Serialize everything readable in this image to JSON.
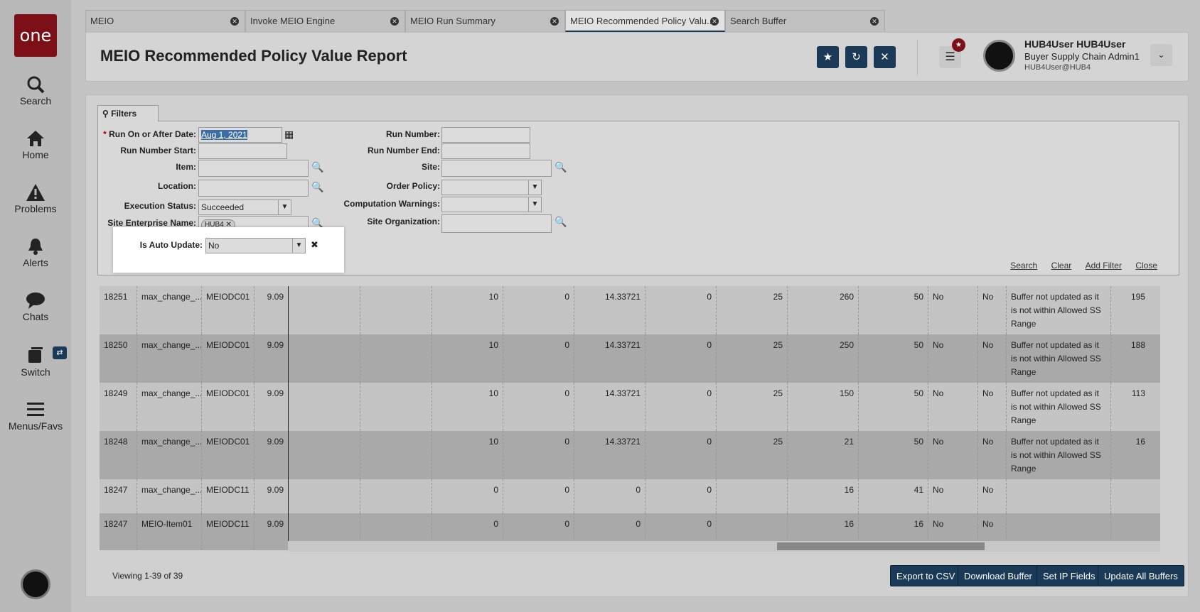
{
  "sidebar": {
    "logo": "one",
    "items": [
      {
        "label": "Search",
        "icon": "search-icon"
      },
      {
        "label": "Home",
        "icon": "home-icon"
      },
      {
        "label": "Problems",
        "icon": "warning-icon"
      },
      {
        "label": "Alerts",
        "icon": "bell-icon"
      },
      {
        "label": "Chats",
        "icon": "chat-icon"
      },
      {
        "label": "Switch",
        "icon": "switch-icon"
      },
      {
        "label": "Menus/Favs",
        "icon": "menu-icon"
      }
    ]
  },
  "tabs": [
    {
      "label": "MEIO"
    },
    {
      "label": "Invoke MEIO Engine"
    },
    {
      "label": "MEIO Run Summary"
    },
    {
      "label": "MEIO Recommended Policy Valu..."
    },
    {
      "label": "Search Buffer"
    }
  ],
  "header": {
    "title": "MEIO Recommended Policy Value Report",
    "user_name": "HUB4User HUB4User",
    "user_role": "Buyer Supply Chain Admin1",
    "user_email": "HUB4User@HUB4"
  },
  "filters": {
    "tab_label": "Filters",
    "run_on_after_label": "Run On or After Date:",
    "run_on_after_value": "Aug 1, 2021",
    "run_number_start_label": "Run Number Start:",
    "item_label": "Item:",
    "location_label": "Location:",
    "execution_status_label": "Execution Status:",
    "execution_status_value": "Succeeded",
    "site_enterprise_label": "Site Enterprise Name:",
    "site_enterprise_chip": "HUB4",
    "is_auto_update_label": "Is Auto Update:",
    "is_auto_update_value": "No",
    "run_number_label": "Run Number:",
    "run_number_end_label": "Run Number End:",
    "site_label": "Site:",
    "order_policy_label": "Order Policy:",
    "computation_warnings_label": "Computation Warnings:",
    "site_org_label": "Site Organization:",
    "links": {
      "search": "Search",
      "clear": "Clear",
      "add_filter": "Add Filter",
      "close": "Close"
    }
  },
  "rows": [
    [
      "18251",
      "max_change_...",
      "MEIODC01",
      "9.09",
      "",
      "",
      "10",
      "0",
      "14.33721",
      "0",
      "25",
      "260",
      "50",
      "No",
      "No",
      "Buffer not updated as it is not within Allowed SS Range",
      "195"
    ],
    [
      "18250",
      "max_change_...",
      "MEIODC01",
      "9.09",
      "",
      "",
      "10",
      "0",
      "14.33721",
      "0",
      "25",
      "250",
      "50",
      "No",
      "No",
      "Buffer not updated as it is not within Allowed SS Range",
      "188"
    ],
    [
      "18249",
      "max_change_...",
      "MEIODC01",
      "9.09",
      "",
      "",
      "10",
      "0",
      "14.33721",
      "0",
      "25",
      "150",
      "50",
      "No",
      "No",
      "Buffer not updated as it is not within Allowed SS Range",
      "113"
    ],
    [
      "18248",
      "max_change_...",
      "MEIODC01",
      "9.09",
      "",
      "",
      "10",
      "0",
      "14.33721",
      "0",
      "25",
      "21",
      "50",
      "No",
      "No",
      "Buffer not updated as it is not within Allowed SS Range",
      "16"
    ],
    [
      "18247",
      "max_change_...",
      "MEIODC11",
      "9.09",
      "",
      "",
      "0",
      "0",
      "0",
      "0",
      "",
      "16",
      "41",
      "No",
      "No",
      "",
      ""
    ],
    [
      "18247",
      "MEIO-Item01",
      "MEIODC11",
      "9.09",
      "",
      "",
      "0",
      "0",
      "0",
      "0",
      "",
      "16",
      "16",
      "No",
      "No",
      "",
      ""
    ]
  ],
  "footer": {
    "viewing": "Viewing 1-39 of 39",
    "buttons": [
      "Export to CSV",
      "Download Buffer",
      "Set IP Fields",
      "Update All Buffers"
    ]
  }
}
